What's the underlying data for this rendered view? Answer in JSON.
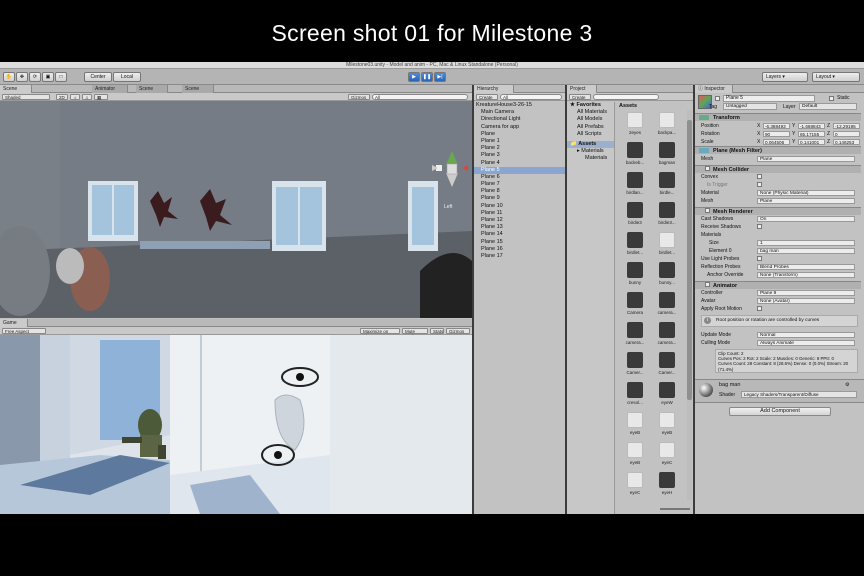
{
  "caption": "Screen shot 01 for Milestone 3",
  "window_title": "Milestone03.unity - Model and anim - PC, Mac & Linux Standalone (Personal)",
  "toolbar": {
    "center": "Center",
    "local": "Local",
    "layers": "Layers",
    "layout": "Layout"
  },
  "scene": {
    "tabs": [
      "Scene",
      "Animator",
      "Scene",
      "Scene"
    ],
    "shading": "Shaded",
    "mode_2d": "2D",
    "gizmos": "Gizmos",
    "search_placeholder": "All",
    "gizmo_label": "Left"
  },
  "game": {
    "tab": "Game",
    "aspect": "Free Aspect",
    "maximize": "Maximize on Play",
    "mute": "Mute audio",
    "stats": "Stats",
    "gizmos": "Gizmos"
  },
  "hierarchy": {
    "tab": "Hierarchy",
    "create": "Create",
    "search_placeholder": "All",
    "items": [
      "KreatureHouse3-26-15",
      "Main Camera",
      "Directional Light",
      "Camera for app",
      "Plane",
      "Plane 1",
      "Plane 2",
      "Plane 3",
      "Plane 4",
      "Plane 5",
      "Plane 6",
      "Plane 7",
      "Plane 8",
      "Plane 9",
      "Plane 10",
      "Plane 11",
      "Plane 12",
      "Plane 13",
      "Plane 14",
      "Plane 15",
      "Plane 16",
      "Plane 17"
    ],
    "selected": "Plane 5"
  },
  "project": {
    "tab": "Project",
    "create": "Create",
    "favorites_title": "Favorites",
    "favorites": [
      "All Materials",
      "All Models",
      "All Prefabs",
      "All Scripts"
    ],
    "assets_title": "Assets",
    "tree": [
      "Materials",
      "Materials"
    ],
    "assets_header": "Assets",
    "asset_labels": [
      "2eyes",
      "backpa...",
      "backeb...",
      "bagman",
      "birdlan...",
      "birdle...",
      "birdie3",
      "birdie3...",
      "birdlet...",
      "birdlet...",
      "bunny",
      "bunny...",
      "Camera",
      "camera...",
      "camera...",
      "camera...",
      "Camer...",
      "Camer...",
      "cresol...",
      "eyeW",
      "eyeB",
      "eyeB",
      "eyeB",
      "eyeC",
      "eyeC",
      "eyeH"
    ]
  },
  "inspector": {
    "tab": "Inspector",
    "object_name": "Plane 5",
    "static": "Static",
    "tag_label": "Tag",
    "tag": "Untagged",
    "layer_label": "Layer",
    "layer": "Default",
    "transform": {
      "title": "Transform",
      "position_label": "Position",
      "rotation_label": "Rotation",
      "scale_label": "Scale",
      "position": [
        "-6.388493",
        "-1.668843",
        "-12.29195"
      ],
      "rotation": [
        "90",
        "65.17155",
        "0"
      ],
      "scale": [
        "0.064506",
        "0.141001",
        "0.146253"
      ]
    },
    "mesh_filter": {
      "title": "Plane (Mesh Filter)",
      "mesh_label": "Mesh",
      "mesh": "Plane"
    },
    "mesh_collider": {
      "title": "Mesh Collider",
      "convex": "Convex",
      "trigger": "Is Trigger",
      "material_label": "Material",
      "material": "None (Physic Material)",
      "mesh_label": "Mesh",
      "mesh": "Plane"
    },
    "mesh_renderer": {
      "title": "Mesh Renderer",
      "cast_shadows_label": "Cast Shadows",
      "cast_shadows": "On",
      "receive_shadows": "Receive Shadows",
      "materials": "Materials",
      "size_label": "Size",
      "size": "1",
      "element_label": "Element 0",
      "element": "bag man",
      "light_probes": "Use Light Probes",
      "reflection_label": "Reflection Probes",
      "reflection": "Blend Probes",
      "anchor_label": "Anchor Override",
      "anchor": "None (Transform)"
    },
    "animator": {
      "title": "Animator",
      "controller_label": "Controller",
      "controller": "Plane 9",
      "avatar_label": "Avatar",
      "avatar": "None (Avatar)",
      "root_motion": "Apply Root Motion",
      "info": "Root position or rotation are controlled by curves",
      "update_label": "Update Mode",
      "update": "Normal",
      "culling_label": "Culling Mode",
      "culling": "Always Animate",
      "clip_info": "Clip Count: 2\nCurves Pos: 2 Rot: 2 Scale: 2 Muscles: 0 Generic: 8 PPtr: 0\nCurves Count: 28 Constant: 8 (28.6%) Dense: 0 (0.0%) Stream: 20 (71.4%)"
    },
    "material": {
      "name": "bag man",
      "shader_label": "Shader",
      "shader": "Legacy Shaders/Transparent/Diffuse"
    },
    "add_component": "Add Component"
  }
}
